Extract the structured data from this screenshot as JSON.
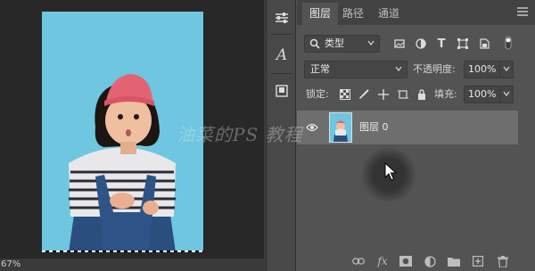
{
  "status": {
    "zoom": "67%"
  },
  "tabs": [
    {
      "label": "图层",
      "active": true
    },
    {
      "label": "路径",
      "active": false
    },
    {
      "label": "通道",
      "active": false
    }
  ],
  "filter": {
    "kind_label": "类型"
  },
  "blend": {
    "mode": "正常",
    "opacity_label": "不透明度:",
    "opacity_value": "100%"
  },
  "lock": {
    "label": "锁定:",
    "fill_label": "填充:",
    "fill_value": "100%"
  },
  "layer": {
    "name": "图层 0"
  },
  "watermark": {
    "text": "油菜的PS 教程"
  },
  "colors": {
    "canvas_bg": "#282828",
    "photo_bg": "#6ec6e0",
    "panel": "#535353",
    "selected_row": "#6e6e6e"
  },
  "icons": {
    "tool_strip": [
      "adjust-sliders-icon",
      "character-a-icon",
      "paragraph-icon"
    ],
    "filter_tools": [
      "pixel-layer-filter-icon",
      "adjustment-filter-icon",
      "type-filter-icon",
      "shape-filter-icon",
      "smart-object-filter-icon",
      "filter-toggle-icon"
    ],
    "lock_tools": [
      "lock-transparent-icon",
      "lock-paint-icon",
      "lock-position-icon",
      "lock-artboard-icon",
      "lock-all-icon"
    ],
    "bottom_tools": [
      "link-layers-icon",
      "fx-icon",
      "add-mask-icon",
      "adjustment-layer-icon",
      "group-folder-icon",
      "new-layer-icon",
      "delete-icon"
    ]
  }
}
